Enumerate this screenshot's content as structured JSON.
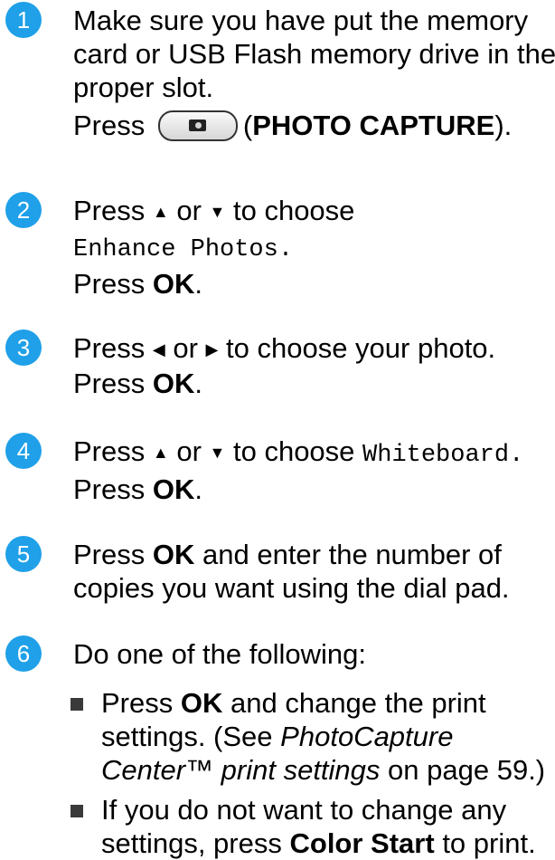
{
  "steps": [
    {
      "number": "1",
      "lines": [
        "Make sure you have put the memory",
        "card or USB Flash memory drive in the",
        "proper slot."
      ],
      "press_prefix": "Press",
      "button_icon": "camera-icon",
      "open_paren": "(",
      "button_label": "PHOTO CAPTURE",
      "close_paren": ")."
    },
    {
      "number": "2",
      "press": "Press",
      "up": "▲",
      "or": "or",
      "down": "▼",
      "choose": "to choose",
      "option": "Enhance Photos",
      "dot": ".",
      "press2": "Press",
      "ok": "OK",
      "period": "."
    },
    {
      "number": "3",
      "press": "Press",
      "left": "◀",
      "or": "or",
      "right": "▶",
      "choose": "to choose your photo.",
      "press2": "Press",
      "ok": "OK",
      "period": "."
    },
    {
      "number": "4",
      "press": "Press",
      "up": "▲",
      "or": "or",
      "down": "▼",
      "choose": "to choose",
      "option": "Whiteboard",
      "dot": ".",
      "press2": "Press",
      "ok": "OK",
      "period": "."
    },
    {
      "number": "5",
      "press": "Press",
      "ok": "OK",
      "rest": "and enter the number of",
      "line2": "copies you want using the dial pad."
    },
    {
      "number": "6",
      "text": "Do one of the following:",
      "bullets": [
        {
          "l1_pre": "Press",
          "l1_ok": "OK",
          "l1_post": "and change the print",
          "l2_pre": "settings. (See",
          "l2_it": "PhotoCapture",
          "l3_it": "Center™ print settings",
          "l3_post": "on page 59.)"
        },
        {
          "l1": "If you do not want to change any",
          "l2_pre": "settings, press",
          "l2_bold": "Color Start",
          "l2_post": "to print."
        }
      ]
    }
  ],
  "colors": {
    "step_number_bg": "#1fa0e8",
    "bullet": "#3a3a3a"
  }
}
